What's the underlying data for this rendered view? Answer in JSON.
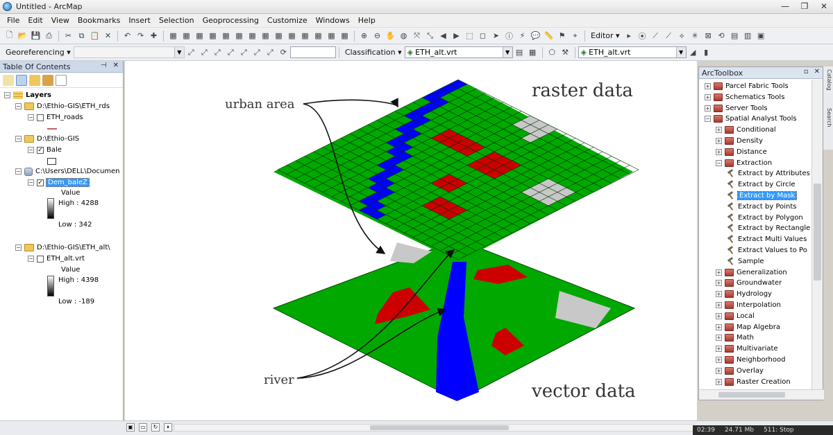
{
  "window": {
    "title": "Untitled - ArcMap",
    "controls": [
      "—",
      "❐",
      "✕"
    ]
  },
  "menu": [
    "File",
    "Edit",
    "View",
    "Bookmarks",
    "Insert",
    "Selection",
    "Geoprocessing",
    "Customize",
    "Windows",
    "Help"
  ],
  "toolbar2": {
    "georef_label": "Georeferencing ▾",
    "classification_label": "Classification ▾",
    "layer_combo_1": "ETH_alt.vrt",
    "layer_combo_2": "ETH_alt.vrt",
    "editor_label": "Editor ▾"
  },
  "toc": {
    "title": "Table Of Contents",
    "header_buttons": [
      "⊣",
      "✕"
    ],
    "items": [
      {
        "label": "Layers"
      },
      {
        "label": "D:\\Ethio-GIS\\ETH_rds"
      },
      {
        "label": "ETH_roads"
      },
      {
        "label": "D:\\Ethio-GIS"
      },
      {
        "label": "Bale"
      },
      {
        "label": "C:\\Users\\DELL\\Documen"
      },
      {
        "label": "Dem_baleZ"
      },
      {
        "label": "Value"
      },
      {
        "label": "High : 4288"
      },
      {
        "label": "Low : 342"
      },
      {
        "label": "D:\\Ethio-GIS\\ETH_alt\\"
      },
      {
        "label": "ETH_alt.vrt"
      },
      {
        "label": "Value"
      },
      {
        "label": "High : 4398"
      },
      {
        "label": "Low : -189"
      }
    ]
  },
  "map": {
    "labels": {
      "raster": "raster data",
      "vector": "vector data",
      "urban": "urban area",
      "river": "river"
    },
    "colors": {
      "land": "#00a800",
      "water": "#0000ff",
      "urban": "#c8c8c8",
      "feature": "#cc0000"
    }
  },
  "arctoolbox": {
    "title": "ArcToolbox",
    "header_buttons": [
      "▫",
      "✕"
    ],
    "items": [
      {
        "label": "Parcel Fabric Tools"
      },
      {
        "label": "Schematics Tools"
      },
      {
        "label": "Server Tools"
      },
      {
        "label": "Spatial Analyst Tools"
      },
      {
        "label": "Conditional"
      },
      {
        "label": "Density"
      },
      {
        "label": "Distance"
      },
      {
        "label": "Extraction"
      },
      {
        "label": "Extract by Attributes"
      },
      {
        "label": "Extract by Circle"
      },
      {
        "label": "Extract by Mask"
      },
      {
        "label": "Extract by Points"
      },
      {
        "label": "Extract by Polygon"
      },
      {
        "label": "Extract by Rectangle"
      },
      {
        "label": "Extract Multi Values"
      },
      {
        "label": "Extract Values to Po"
      },
      {
        "label": "Sample"
      },
      {
        "label": "Generalization"
      },
      {
        "label": "Groundwater"
      },
      {
        "label": "Hydrology"
      },
      {
        "label": "Interpolation"
      },
      {
        "label": "Local"
      },
      {
        "label": "Map Algebra"
      },
      {
        "label": "Math"
      },
      {
        "label": "Multivariate"
      },
      {
        "label": "Neighborhood"
      },
      {
        "label": "Overlay"
      },
      {
        "label": "Raster Creation"
      }
    ]
  },
  "side_tabs": [
    "Catalog",
    "Search"
  ],
  "taskbar": [
    "02:39",
    "24.71 Mb",
    "511: Stop"
  ]
}
